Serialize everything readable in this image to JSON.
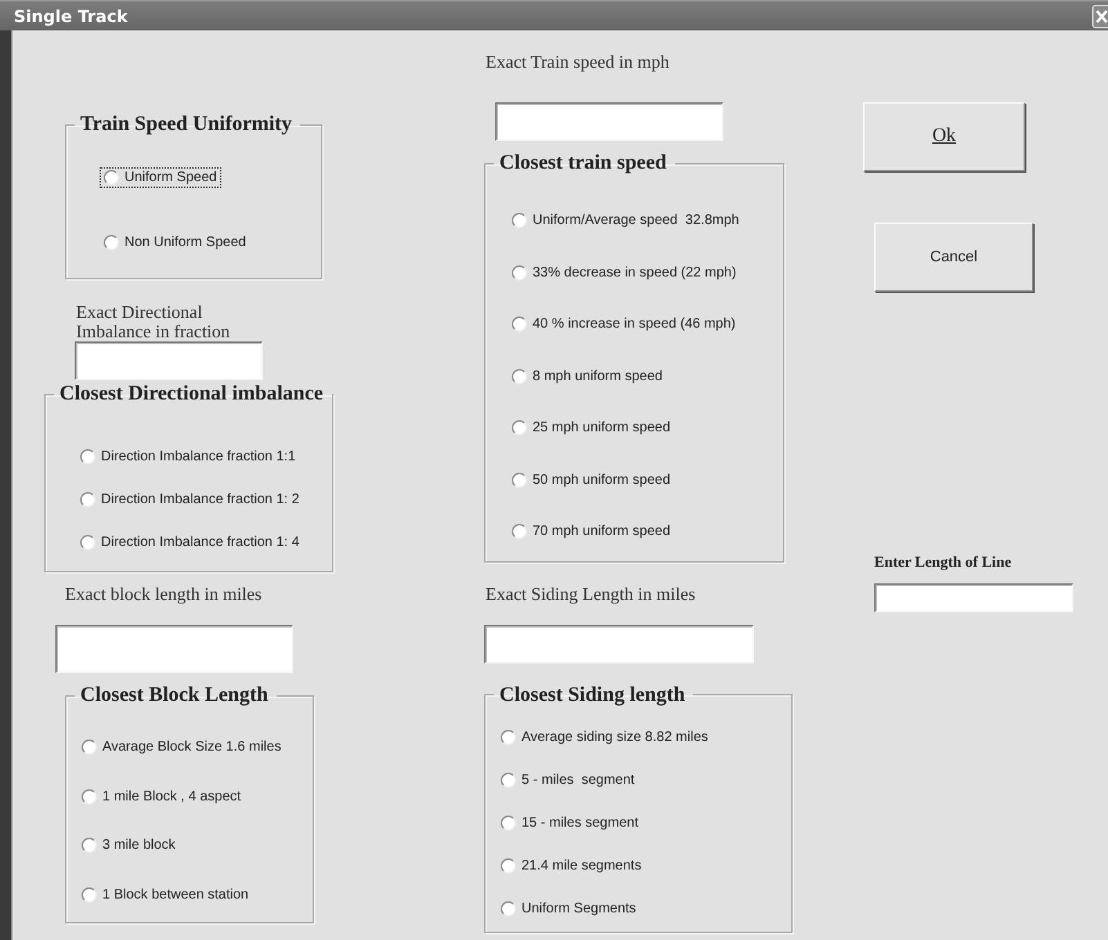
{
  "window": {
    "title": "Single Track"
  },
  "speed_uniformity": {
    "title": "Train Speed Uniformity",
    "options": [
      {
        "label": "Uniform Speed",
        "selected": false,
        "focused": true
      },
      {
        "label": "Non Uniform Speed",
        "selected": false,
        "focused": false
      }
    ]
  },
  "directional_imbalance": {
    "label": "Exact Directional Imbalance in fraction"
  },
  "closest_directional_imbalance": {
    "title": "Closest Directional imbalance",
    "options": [
      {
        "label": "Direction Imbalance fraction 1:1",
        "selected": false
      },
      {
        "label": "Direction Imbalance fraction 1: 2",
        "selected": false
      },
      {
        "label": "Direction Imbalance fraction 1: 4",
        "selected": false
      }
    ]
  },
  "block_length": {
    "label": "Exact block length in miles"
  },
  "closest_block_length": {
    "title": "Closest Block Length",
    "options": [
      {
        "label": "Avarage Block Size 1.6 miles",
        "selected": false
      },
      {
        "label": "1 mile Block , 4 aspect",
        "selected": false
      },
      {
        "label": "3 mile block",
        "selected": false
      },
      {
        "label": "1 Block between station",
        "selected": false
      }
    ]
  },
  "train_speed": {
    "label": "Exact Train speed in mph"
  },
  "closest_train_speed": {
    "title": "Closest train speed",
    "options": [
      {
        "label": "Uniform/Average speed  32.8mph",
        "selected": false
      },
      {
        "label": "33% decrease in speed (22 mph)",
        "selected": false
      },
      {
        "label": "40 % increase in speed (46 mph)",
        "selected": false
      },
      {
        "label": "8 mph uniform speed",
        "selected": false
      },
      {
        "label": "25 mph uniform speed",
        "selected": false
      },
      {
        "label": "50 mph uniform speed",
        "selected": false
      },
      {
        "label": "70 mph uniform speed",
        "selected": false
      }
    ]
  },
  "siding_length": {
    "label": "Exact Siding Length in miles"
  },
  "closest_siding_length": {
    "title": "Closest Siding length",
    "options": [
      {
        "label": "Average siding size 8.82 miles",
        "selected": false
      },
      {
        "label": "5 - miles  segment",
        "selected": false
      },
      {
        "label": "15 - miles segment",
        "selected": false
      },
      {
        "label": "21.4 mile segments",
        "selected": false
      },
      {
        "label": "Uniform Segments",
        "selected": false
      }
    ]
  },
  "buttons": [
    {
      "label": "Ok",
      "kind": "default"
    },
    {
      "label": "Cancel",
      "kind": "normal"
    }
  ],
  "line_length": {
    "label": "Enter Length of Line"
  }
}
